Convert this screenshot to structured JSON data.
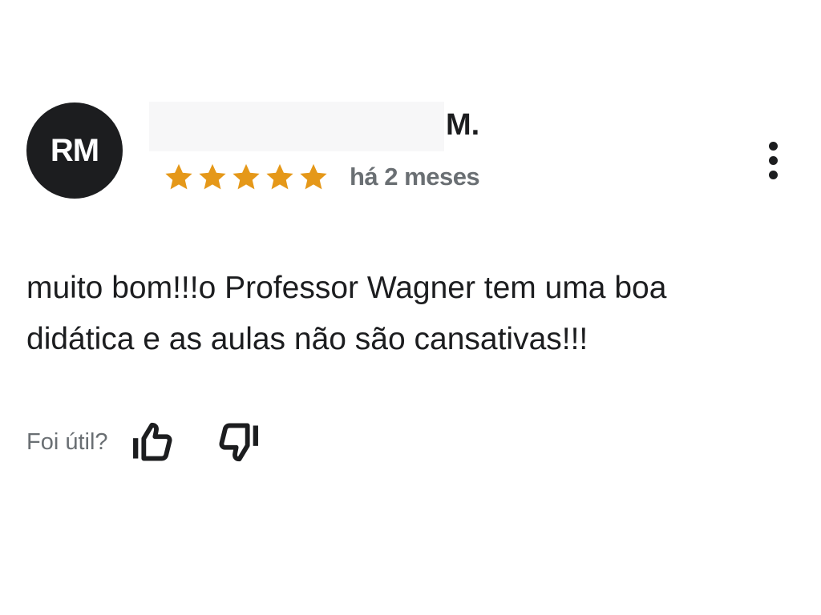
{
  "review": {
    "avatar_initials": "RM",
    "reviewer_name_suffix": "M.",
    "rating": 5,
    "rating_max": 5,
    "star_color": "#e59819",
    "date": "há 2 meses",
    "text_line1": "muito bom!!!o Professor Wagner tem uma boa",
    "text_line2": "didática e as aulas não são cansativas!!!",
    "more_icon": "more-vertical-icon"
  },
  "feedback": {
    "helpful_label": "Foi útil?",
    "thumbs_up_icon": "thumbs-up-icon",
    "thumbs_down_icon": "thumbs-down-icon"
  }
}
